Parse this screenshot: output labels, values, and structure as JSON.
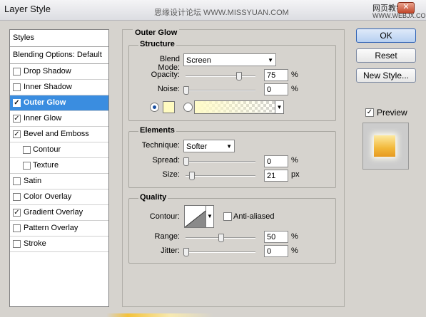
{
  "window": {
    "title": "Layer Style",
    "watermark_left": "思缘设计论坛 WWW.MISSYUAN.COM",
    "watermark_right": "网页教学网",
    "watermark_url": "WWW.WEBJX.COM",
    "close_label": "✕"
  },
  "styles_list": {
    "header": "Styles",
    "blend_header": "Blending Options: Default",
    "items": [
      {
        "label": "Drop Shadow",
        "checked": false
      },
      {
        "label": "Inner Shadow",
        "checked": false
      },
      {
        "label": "Outer Glow",
        "checked": true,
        "selected": true
      },
      {
        "label": "Inner Glow",
        "checked": true
      },
      {
        "label": "Bevel and Emboss",
        "checked": true
      },
      {
        "label": "Contour",
        "checked": false,
        "sub": true
      },
      {
        "label": "Texture",
        "checked": false,
        "sub": true
      },
      {
        "label": "Satin",
        "checked": false
      },
      {
        "label": "Color Overlay",
        "checked": false
      },
      {
        "label": "Gradient Overlay",
        "checked": true
      },
      {
        "label": "Pattern Overlay",
        "checked": false
      },
      {
        "label": "Stroke",
        "checked": false
      }
    ]
  },
  "outer_glow": {
    "title": "Outer Glow",
    "structure": {
      "title": "Structure",
      "blend_mode_label": "Blend Mode:",
      "blend_mode_value": "Screen",
      "opacity_label": "Opacity:",
      "opacity_value": "75",
      "opacity_unit": "%",
      "opacity_fraction": 0.75,
      "noise_label": "Noise:",
      "noise_value": "0",
      "noise_unit": "%",
      "noise_fraction": 0,
      "color_mode": "solid",
      "glow_color": "#fffbc0"
    },
    "elements": {
      "title": "Elements",
      "technique_label": "Technique:",
      "technique_value": "Softer",
      "spread_label": "Spread:",
      "spread_value": "0",
      "spread_unit": "%",
      "spread_fraction": 0,
      "size_label": "Size:",
      "size_value": "21",
      "size_unit": "px",
      "size_fraction": 0.084
    },
    "quality": {
      "title": "Quality",
      "contour_label": "Contour:",
      "anti_aliased_label": "Anti-aliased",
      "anti_aliased": false,
      "range_label": "Range:",
      "range_value": "50",
      "range_unit": "%",
      "range_fraction": 0.5,
      "jitter_label": "Jitter:",
      "jitter_value": "0",
      "jitter_unit": "%",
      "jitter_fraction": 0
    }
  },
  "buttons": {
    "ok": "OK",
    "reset": "Reset",
    "new_style": "New Style...",
    "preview_label": "Preview",
    "preview_checked": true
  }
}
